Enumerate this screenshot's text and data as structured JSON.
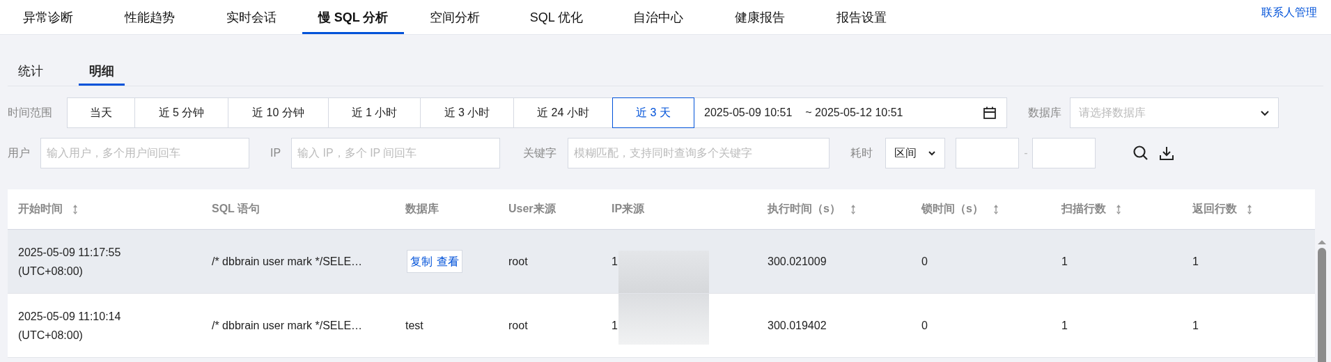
{
  "nav": {
    "tabs": [
      {
        "label": "异常诊断",
        "selected": false
      },
      {
        "label": "性能趋势",
        "selected": false
      },
      {
        "label": "实时会话",
        "selected": false
      },
      {
        "label": "慢 SQL 分析",
        "selected": true
      },
      {
        "label": "空间分析",
        "selected": false
      },
      {
        "label": "SQL 优化",
        "selected": false
      },
      {
        "label": "自治中心",
        "selected": false
      },
      {
        "label": "健康报告",
        "selected": false
      },
      {
        "label": "报告设置",
        "selected": false
      }
    ],
    "link": "联系人管理"
  },
  "subtabs": [
    {
      "label": "统计",
      "selected": false
    },
    {
      "label": "明细",
      "selected": true
    }
  ],
  "filters": {
    "time_label": "时间范围",
    "time_ranges": [
      {
        "label": "当天",
        "selected": false
      },
      {
        "label": "近 5 分钟",
        "selected": false
      },
      {
        "label": "近 10 分钟",
        "selected": false
      },
      {
        "label": "近 1 小时",
        "selected": false
      },
      {
        "label": "近 3 小时",
        "selected": false
      },
      {
        "label": "近 24 小时",
        "selected": false
      },
      {
        "label": "近 3 天",
        "selected": true
      }
    ],
    "start": "2025-05-09 10:51",
    "end": "~ 2025-05-12 10:51",
    "database_label": "数据库",
    "database": {
      "placeholder": "请选择数据库"
    },
    "user_label": "用户",
    "user": {
      "placeholder": "输入用户，多个用户间回车"
    },
    "ip_label": "IP",
    "ip": {
      "placeholder": "输入 IP，多个 IP 间回车"
    },
    "keyword_label": "关键字",
    "keyword": {
      "placeholder": "模糊匹配，支持同时查询多个关键字"
    },
    "duration_label": "耗时",
    "duration_mode": "区间",
    "range_separator": "-"
  },
  "table": {
    "columns": [
      {
        "label": "开始时间",
        "sortable": true
      },
      {
        "label": "SQL 语句",
        "sortable": false
      },
      {
        "label": "数据库",
        "sortable": false
      },
      {
        "label": "User来源",
        "sortable": false
      },
      {
        "label": "IP来源",
        "sortable": false
      },
      {
        "label": "执行时间（s）",
        "sortable": true
      },
      {
        "label": "锁时间（s）",
        "sortable": true
      },
      {
        "label": "扫描行数",
        "sortable": true
      },
      {
        "label": "返回行数",
        "sortable": true
      }
    ],
    "rows": [
      {
        "hovered": true,
        "start": "2025-05-09 11:17:55",
        "tz": "(UTC+08:00)",
        "sql": "/* dbbrain user mark */SELE…",
        "actions": [
          "复制",
          "查看"
        ],
        "user": "root",
        "ip": "1",
        "exec": "300.021009",
        "lock": "0",
        "scan": "1",
        "ret": "1"
      },
      {
        "hovered": false,
        "start": "2025-05-09 11:10:14",
        "tz": "(UTC+08:00)",
        "sql": "/* dbbrain user mark */SELE…",
        "database": "test",
        "user": "root",
        "ip": "1",
        "exec": "300.019402",
        "lock": "0",
        "scan": "1",
        "ret": "1"
      }
    ]
  }
}
